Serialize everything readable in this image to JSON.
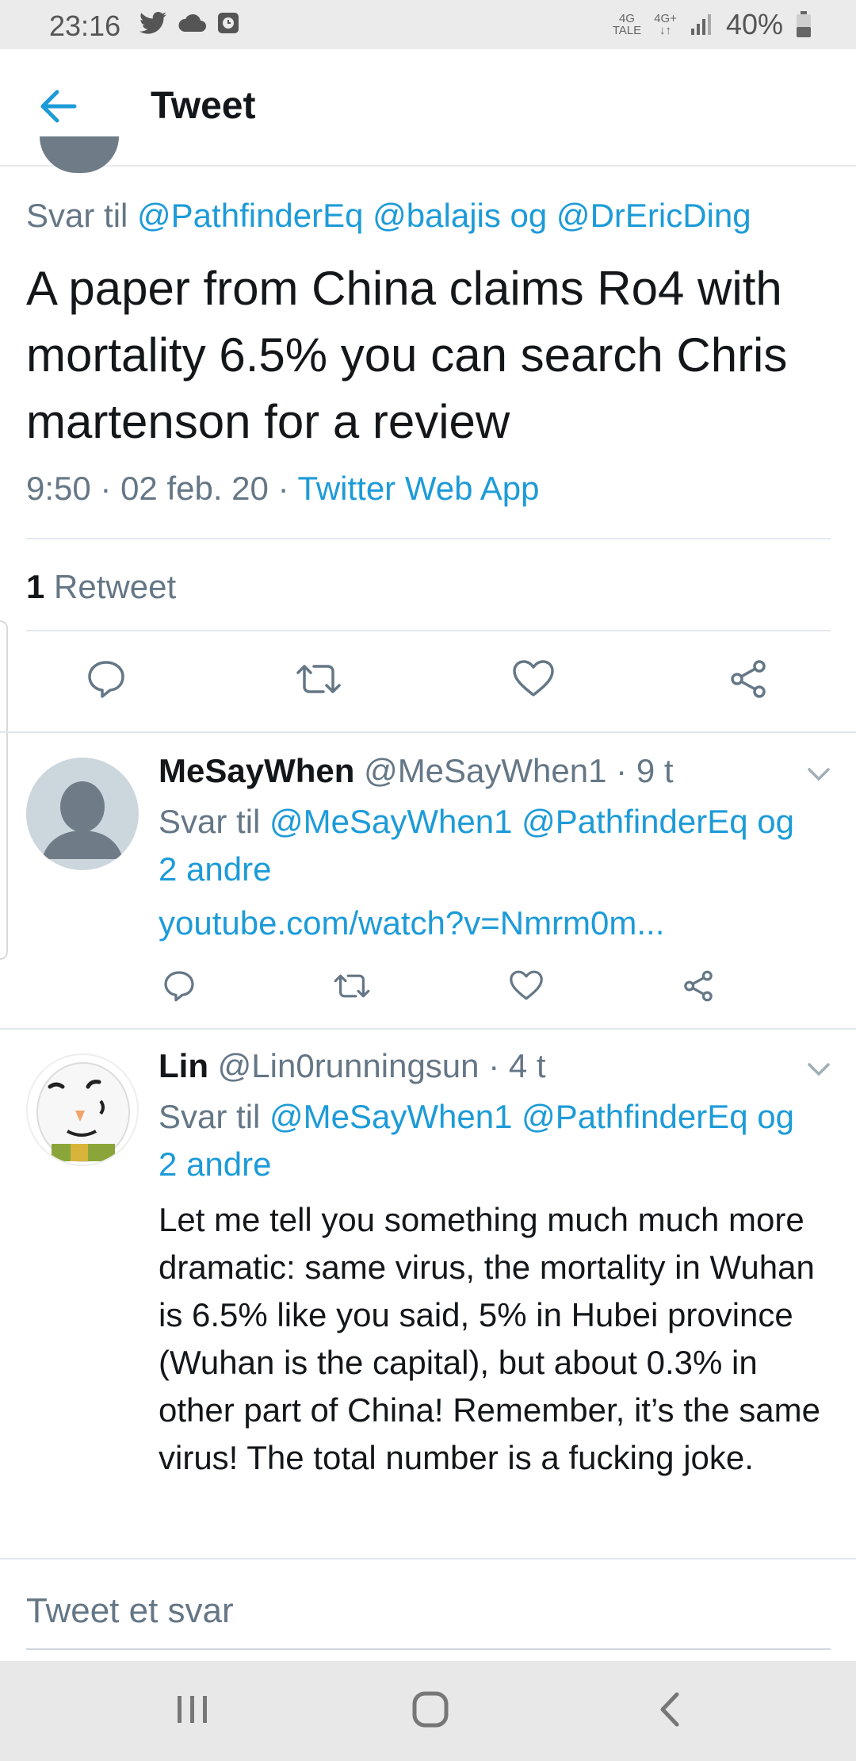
{
  "status_bar": {
    "time": "23:16",
    "network_top": "4G",
    "network_bottom": "TALE",
    "network2": "4G+",
    "battery": "40%"
  },
  "header": {
    "title": "Tweet"
  },
  "main_tweet": {
    "reply_prefix": "Svar til",
    "reply_mentions": "@PathfinderEq @balajis og @DrEricDing",
    "text": "A paper from China claims Ro4 with mortality 6.5% you can search Chris martenson for a review",
    "timestamp": "9:50 · 02 feb. 20 ·",
    "source": "Twitter Web App",
    "retweet_count": "1",
    "retweet_label": "Retweet"
  },
  "replies": [
    {
      "name": "MeSayWhen",
      "handle": "@MeSayWhen1 · 9 t",
      "reply_prefix": "Svar til",
      "reply_mentions_line1": "@MeSayWhen1 @PathfinderEq og",
      "reply_mentions_line2": "2 andre",
      "link": "youtube.com/watch?v=Nmrm0m..."
    },
    {
      "name": "Lin",
      "handle": "@Lin0runningsun · 4 t",
      "reply_prefix": "Svar til",
      "reply_mentions_line1": "@MeSayWhen1 @PathfinderEq og",
      "reply_mentions_line2": "2 andre",
      "text": "Let me tell you something much much more dramatic: same virus, the mortality in Wuhan is 6.5% like you said, 5% in Hubei province (Wuhan is the capital), but about 0.3% in other part of China! Remember, it’s the same virus! The total number is a fucking joke."
    }
  ],
  "compose": {
    "placeholder": "Tweet et svar"
  },
  "colors": {
    "link": "#1d9bd8",
    "secondary_text": "#657786",
    "primary_text": "#14171a",
    "icon": "#657786"
  },
  "icons": [
    "twitter-icon",
    "cloud-icon",
    "clock-icon",
    "signal-icon",
    "battery-icon",
    "back-arrow-icon",
    "reply-icon",
    "retweet-icon",
    "like-icon",
    "share-icon",
    "chevron-down-icon",
    "recents-icon",
    "home-icon",
    "back-icon"
  ]
}
